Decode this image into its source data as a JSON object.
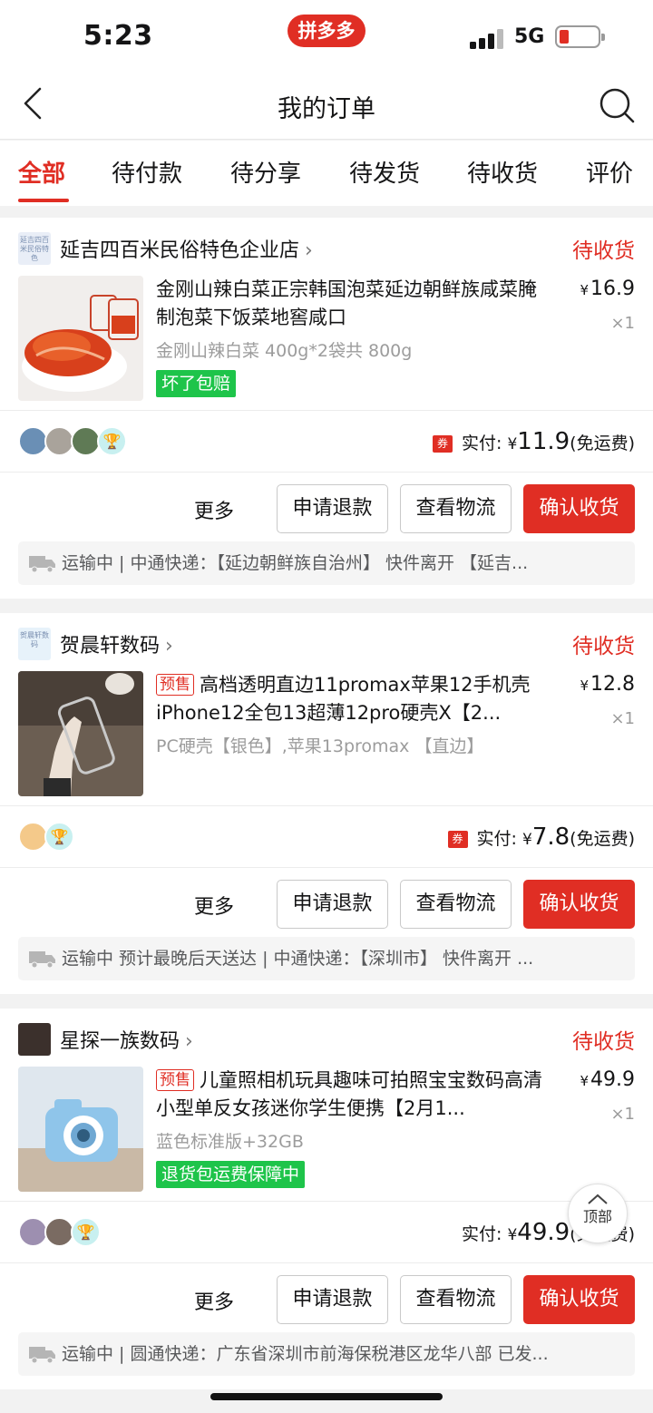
{
  "status_bar": {
    "time": "5:23",
    "app_badge": "拼多多",
    "network": "5G",
    "battery_color": "#e02e24"
  },
  "navbar": {
    "title": "我的订单",
    "back_icon": "chevron-left-icon",
    "search_icon": "search-icon"
  },
  "tabs": [
    "全部",
    "待付款",
    "待分享",
    "待发货",
    "待收货",
    "评价"
  ],
  "active_tab": "全部",
  "actions": {
    "more": "更多",
    "refund": "申请退款",
    "logistics": "查看物流",
    "confirm": "确认收货"
  },
  "pay_label": "实付:",
  "currency": "¥",
  "coupon_label": "券",
  "orders": [
    {
      "store_logo_text": "延吉四百米民俗特色",
      "store_name": "延吉四百米民俗特色企业店",
      "status": "待收货",
      "title": "金刚山辣白菜正宗韩国泡菜延边朝鲜族咸菜腌制泡菜下饭菜地窖咸口",
      "presale": "",
      "price": "16.9",
      "qty": "×1",
      "spec": "金刚山辣白菜 400g*2袋共 800g",
      "guarantee": "坏了包赔",
      "pay_amount": "11.9",
      "shipping": "(免运费)",
      "logistics": "运输中 | 中通快递：【延边朝鲜族自治州】 快件离开 【延吉..."
    },
    {
      "store_logo_text": "贺晨轩数码",
      "store_name": "贺晨轩数码",
      "status": "待收货",
      "title": "高档透明直边11promax苹果12手机壳iPhone12全包13超薄12pro硬壳X【2...",
      "presale": "预售",
      "price": "12.8",
      "qty": "×1",
      "spec": "PC硬壳【银色】,苹果13promax 【直边】",
      "guarantee": "",
      "pay_amount": "7.8",
      "shipping": "(免运费)",
      "logistics": "运输中 预计最晚后天送达 | 中通快递：【深圳市】 快件离开 ..."
    },
    {
      "store_logo_text": "",
      "store_name": "星探一族数码",
      "status": "待收货",
      "title": "儿童照相机玩具趣味可拍照宝宝数码高清小型单反女孩迷你学生便携【2月1...",
      "presale": "预售",
      "price": "49.9",
      "qty": "×1",
      "spec": "蓝色标准版+32GB",
      "guarantee": "退货包运费保障中",
      "pay_amount": "49.9",
      "shipping": "(免运费)",
      "logistics": "运输中 | 圆通快递：广东省深圳市前海保税港区龙华八部 已发..."
    }
  ],
  "back_to_top": "顶部",
  "colors": {
    "accent": "#e02e24",
    "guarantee_green": "#1ec44a",
    "muted_text": "#9c9c9c"
  }
}
